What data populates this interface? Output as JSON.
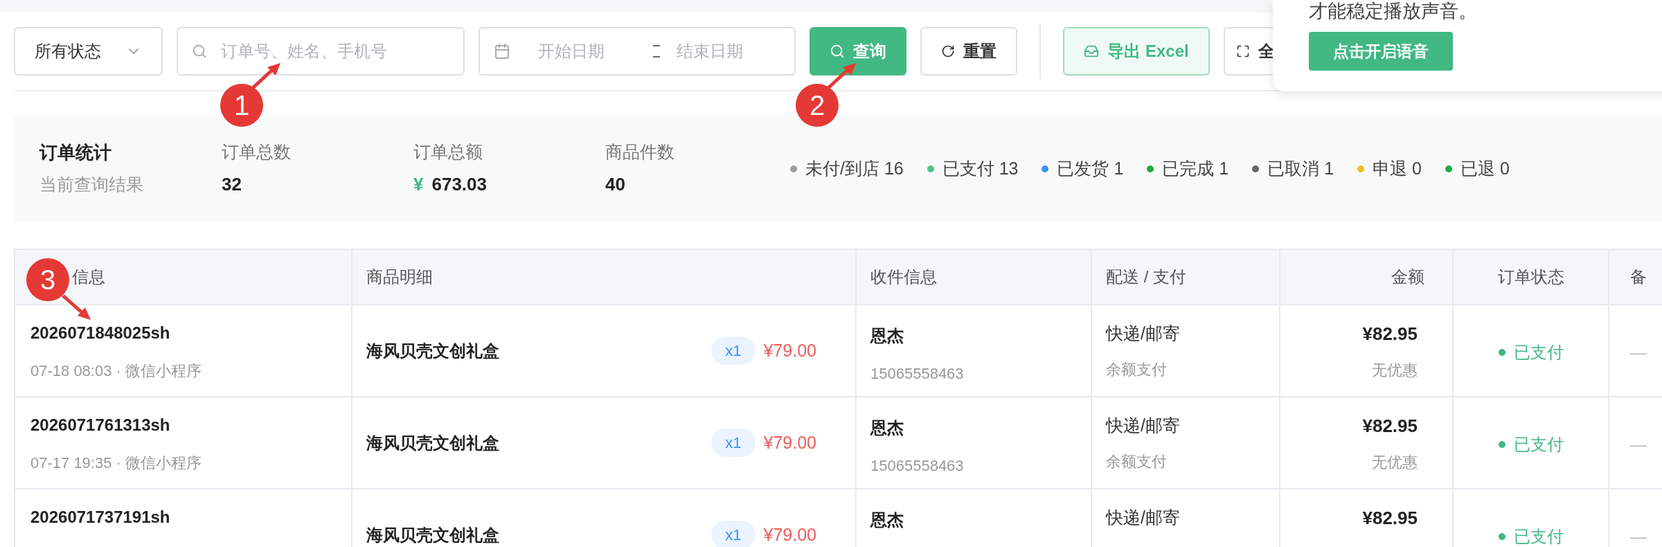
{
  "filters": {
    "status_select": "所有状态",
    "search": {
      "placeholder": "订单号、姓名、手机号"
    },
    "date_range": {
      "start_placeholder": "开始日期",
      "end_placeholder": "结束日期"
    }
  },
  "buttons": [
    {
      "kind": "primary",
      "label": "查询"
    },
    {
      "kind": "plain",
      "label": "重置"
    },
    {
      "kind": "divider"
    },
    {
      "kind": "export",
      "label": "导出 Excel"
    },
    {
      "kind": "fullscreen",
      "label": "全"
    }
  ],
  "popup": {
    "text": "才能稳定播放声音。",
    "button": "点击开启语音"
  },
  "stats": {
    "title": "订单统计",
    "subtitle": "当前查询结果",
    "metrics": [
      {
        "label": "订单总数",
        "value": "32"
      },
      {
        "label": "订单总额",
        "currency": "¥",
        "value": "673.03"
      },
      {
        "label": "商品件数",
        "value": "40"
      }
    ],
    "statuses": [
      {
        "label": "未付/到店",
        "count": "16",
        "color": "#9e9e9e"
      },
      {
        "label": "已支付",
        "count": "13",
        "color": "#4cc38a"
      },
      {
        "label": "已发货",
        "count": "1",
        "color": "#3b93f5"
      },
      {
        "label": "已完成",
        "count": "1",
        "color": "#22a84a"
      },
      {
        "label": "已取消",
        "count": "1",
        "color": "#666666"
      },
      {
        "label": "申退",
        "count": "0",
        "color": "#f5bd1f"
      },
      {
        "label": "已退",
        "count": "0",
        "color": "#22a84a"
      }
    ]
  },
  "table": {
    "columns": [
      "信息",
      "商品明细",
      "收件信息",
      "配送 / 支付",
      "金额",
      "订单状态",
      "备"
    ],
    "rows": [
      {
        "order_no": "2026071848025sh",
        "time": "07-18 08:03 · 微信小程序",
        "product": "海风贝壳文创礼盒",
        "qty": "x1",
        "price": "¥79.00",
        "name": "恩杰",
        "phone": "15065558463",
        "delivery": "快递/邮寄",
        "payment": "余额支付",
        "amount": "¥82.95",
        "discount": "无优惠",
        "status": "已支付",
        "remark": "—"
      },
      {
        "order_no": "2026071761313sh",
        "time": "07-17 19:35 · 微信小程序",
        "product": "海风贝壳文创礼盒",
        "qty": "x1",
        "price": "¥79.00",
        "name": "恩杰",
        "phone": "15065558463",
        "delivery": "快递/邮寄",
        "payment": "余额支付",
        "amount": "¥82.95",
        "discount": "无优惠",
        "status": "已支付",
        "remark": "—"
      },
      {
        "order_no": "2026071737191sh",
        "product": "海风贝壳文创礼盒",
        "qty": "x1",
        "price": "¥79.00",
        "name": "恩杰",
        "delivery": "快递/邮寄",
        "amount": "¥82.95",
        "status": "已支付",
        "remark": "—"
      }
    ]
  },
  "annotations": [
    {
      "label": "1"
    },
    {
      "label": "2"
    },
    {
      "label": "3"
    }
  ]
}
